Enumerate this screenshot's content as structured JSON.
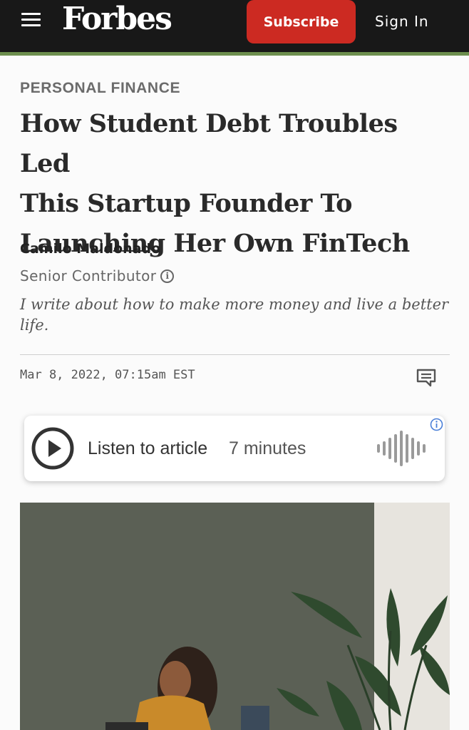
{
  "header": {
    "logo_text": "Forbes",
    "subscribe_label": "Subscribe",
    "signin_label": "Sign In",
    "menu_icon": "hamburger-menu-icon",
    "accent_color": "#cc2a22",
    "bar_color": "#181818",
    "stripe_color": "#6d8f4e"
  },
  "article": {
    "section": "PERSONAL FINANCE",
    "headline_lines": [
      "How Student Debt Troubles Led",
      "This Startup Founder To",
      "Launching Her Own FinTech"
    ],
    "author_name": "Camilo Maldonado",
    "author_role": "Senior Contributor",
    "author_bio": "I write about how to make more money and live a better life.",
    "date": "Mar 8, 2022, 07:15am EST",
    "comment_icon": "comment-icon"
  },
  "audio": {
    "listen_label": "Listen to article",
    "duration": "7 minutes",
    "play_icon": "play-icon",
    "wave_icon": "soundwave-icon",
    "info_icon": "info-icon"
  },
  "hero_image": {
    "icon": "photo-woman-at-desk-with-plant"
  }
}
